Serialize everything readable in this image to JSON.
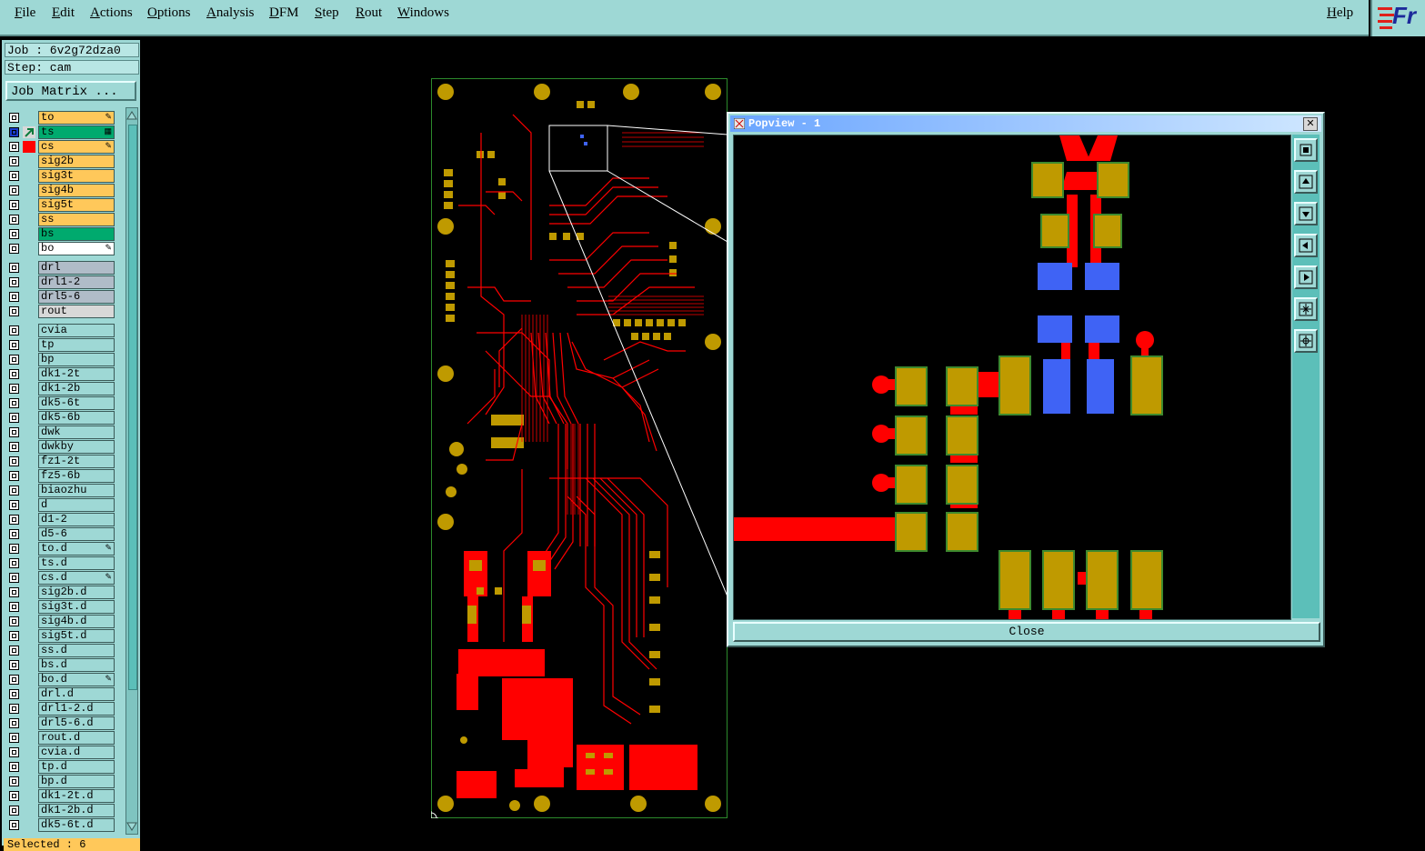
{
  "menubar": {
    "items": [
      "File",
      "Edit",
      "Actions",
      "Options",
      "Analysis",
      "DFM",
      "Step",
      "Rout",
      "Windows"
    ],
    "help": "Help",
    "logo": "Fr"
  },
  "job": {
    "job_label": "Job : 6v2g72dza0",
    "step_label": "Step: cam",
    "matrix_button": "Job Matrix ..."
  },
  "colors": {
    "board_layer": "#ffc85a",
    "sig_layer": "#d8d8d8",
    "drill_layer": "#b0bcc8",
    "doc_layer": "#9ed8d5",
    "solder": "#00aa6e",
    "copper": "#ff0000",
    "pad": "#bf9a00",
    "blue_pad": "#3f63f5"
  },
  "layers": [
    {
      "name": "to",
      "type": "board",
      "flag": "✎"
    },
    {
      "name": "ts",
      "type": "solder",
      "flag": "▦"
    },
    {
      "name": "cs",
      "type": "board",
      "flag": "✎"
    },
    {
      "name": "sig2b",
      "type": "board",
      "flag": ""
    },
    {
      "name": "sig3t",
      "type": "board",
      "flag": ""
    },
    {
      "name": "sig4b",
      "type": "board",
      "flag": ""
    },
    {
      "name": "sig5t",
      "type": "board",
      "flag": ""
    },
    {
      "name": "ss",
      "type": "board",
      "flag": ""
    },
    {
      "name": "bs",
      "type": "solder",
      "flag": ""
    },
    {
      "name": "bo",
      "type": "white",
      "flag": "✎"
    },
    {
      "name": "drl",
      "type": "drill",
      "flag": ""
    },
    {
      "name": "drl1-2",
      "type": "drill",
      "flag": ""
    },
    {
      "name": "drl5-6",
      "type": "drill",
      "flag": ""
    },
    {
      "name": "rout",
      "type": "rout",
      "flag": ""
    },
    {
      "name": "cvia",
      "type": "doc",
      "flag": ""
    },
    {
      "name": "tp",
      "type": "doc",
      "flag": ""
    },
    {
      "name": "bp",
      "type": "doc",
      "flag": ""
    },
    {
      "name": "dk1-2t",
      "type": "doc",
      "flag": ""
    },
    {
      "name": "dk1-2b",
      "type": "doc",
      "flag": ""
    },
    {
      "name": "dk5-6t",
      "type": "doc",
      "flag": ""
    },
    {
      "name": "dk5-6b",
      "type": "doc",
      "flag": ""
    },
    {
      "name": "dwk",
      "type": "doc",
      "flag": ""
    },
    {
      "name": "dwkby",
      "type": "doc",
      "flag": ""
    },
    {
      "name": "fz1-2t",
      "type": "doc",
      "flag": ""
    },
    {
      "name": "fz5-6b",
      "type": "doc",
      "flag": ""
    },
    {
      "name": "biaozhu",
      "type": "doc",
      "flag": ""
    },
    {
      "name": "d",
      "type": "doc",
      "flag": ""
    },
    {
      "name": "d1-2",
      "type": "doc",
      "flag": ""
    },
    {
      "name": "d5-6",
      "type": "doc",
      "flag": ""
    },
    {
      "name": "to.d",
      "type": "doc",
      "flag": "✎"
    },
    {
      "name": "ts.d",
      "type": "doc",
      "flag": ""
    },
    {
      "name": "cs.d",
      "type": "doc",
      "flag": "✎"
    },
    {
      "name": "sig2b.d",
      "type": "doc",
      "flag": ""
    },
    {
      "name": "sig3t.d",
      "type": "doc",
      "flag": ""
    },
    {
      "name": "sig4b.d",
      "type": "doc",
      "flag": ""
    },
    {
      "name": "sig5t.d",
      "type": "doc",
      "flag": ""
    },
    {
      "name": "ss.d",
      "type": "doc",
      "flag": ""
    },
    {
      "name": "bs.d",
      "type": "doc",
      "flag": ""
    },
    {
      "name": "bo.d",
      "type": "doc",
      "flag": "✎"
    },
    {
      "name": "drl.d",
      "type": "doc",
      "flag": ""
    },
    {
      "name": "drl1-2.d",
      "type": "doc",
      "flag": ""
    },
    {
      "name": "drl5-6.d",
      "type": "doc",
      "flag": ""
    },
    {
      "name": "rout.d",
      "type": "doc",
      "flag": ""
    },
    {
      "name": "cvia.d",
      "type": "doc",
      "flag": ""
    },
    {
      "name": "tp.d",
      "type": "doc",
      "flag": ""
    },
    {
      "name": "bp.d",
      "type": "doc",
      "flag": ""
    },
    {
      "name": "dk1-2t.d",
      "type": "doc",
      "flag": ""
    },
    {
      "name": "dk1-2b.d",
      "type": "doc",
      "flag": ""
    },
    {
      "name": "dk5-6t.d",
      "type": "doc",
      "flag": ""
    }
  ],
  "status": {
    "selected": "Selected : 6"
  },
  "popview": {
    "title": "Popview - 1",
    "close_label": "Close",
    "close_x": "✕",
    "tools": [
      "zoom-fit-icon",
      "pan-up-icon",
      "pan-down-icon",
      "pan-left-icon",
      "pan-right-icon",
      "zoom-out-icon",
      "zoom-in-icon"
    ]
  }
}
